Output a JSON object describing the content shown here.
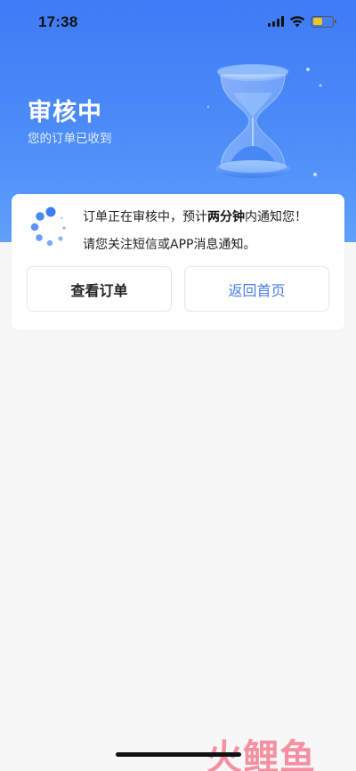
{
  "status_bar": {
    "time": "17:38",
    "icons": [
      "signal-icon",
      "wifi-icon",
      "battery-icon"
    ]
  },
  "header": {
    "title": "审核中",
    "subtitle": "您的订单已收到"
  },
  "notice": {
    "prefix": "订单正在审核中，预计",
    "emphasis": "两分钟",
    "suffix": "内通知您！",
    "line2": "请您关注短信或APP消息通知。"
  },
  "buttons": {
    "view_orders": "查看订单",
    "back_home": "返回首页"
  },
  "watermark": "火鲤鱼",
  "colors": {
    "hero_top": "#3f7bf6",
    "hero_bottom": "#5ea0fb",
    "accent": "#4a7ee6",
    "battery": "#f5c518"
  }
}
